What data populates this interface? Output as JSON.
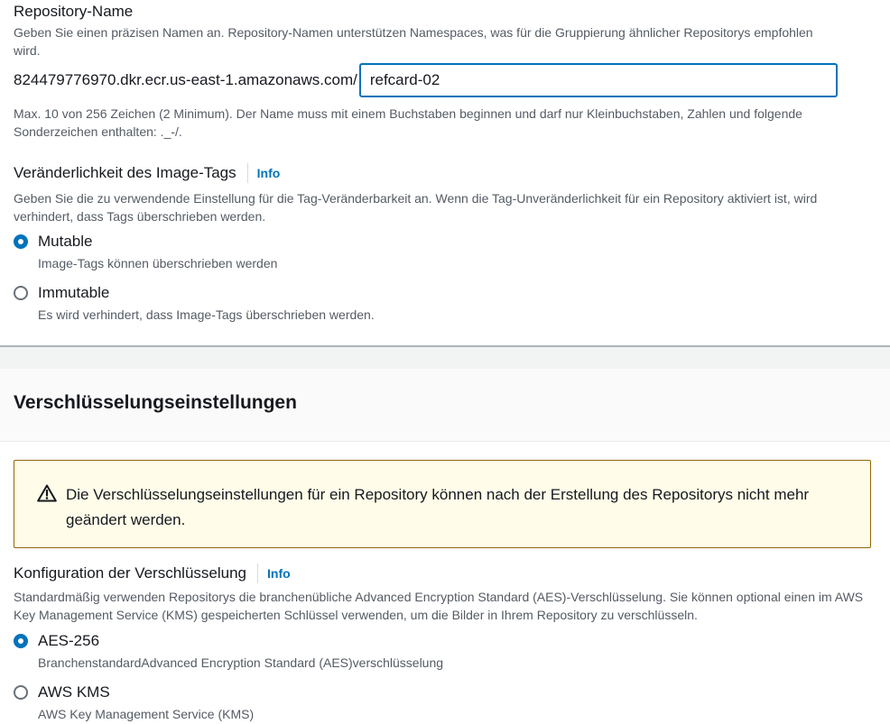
{
  "repo": {
    "name_label": "Repository-Name",
    "name_desc": "Geben Sie einen präzisen Namen an. Repository-Namen unterstützen Namespaces, was für die Gruppierung ähnlicher Repositorys empfohlen wird.",
    "uri_prefix": "824479776970.dkr.ecr.us-east-1.amazonaws.com/",
    "name_value": "refcard-02",
    "constraint": "Max. 10 von 256 Zeichen (2 Minimum). Der Name muss mit einem Buchstaben beginnen und darf nur Kleinbuchstaben, Zahlen und folgende Sonderzeichen enthalten: ._-/."
  },
  "tag_mutability": {
    "heading": "Veränderlichkeit des Image-Tags",
    "info": "Info",
    "desc": "Geben Sie die zu verwendende Einstellung für die Tag-Veränderbarkeit an. Wenn die Tag-Unveränderlichkeit für ein Repository aktiviert ist, wird verhindert, dass Tags überschrieben werden.",
    "options": [
      {
        "label": "Mutable",
        "desc": "Image-Tags können überschrieben werden",
        "checked": true
      },
      {
        "label": "Immutable",
        "desc": "Es wird verhindert, dass Image-Tags überschrieben werden.",
        "checked": false
      }
    ]
  },
  "encryption": {
    "title": "Verschlüsselungseinstellungen",
    "warning": "Die Verschlüsselungseinstellungen für ein Repository können nach der Erstellung des Repositorys nicht mehr geändert werden.",
    "config_heading": "Konfiguration der Verschlüsselung",
    "info": "Info",
    "config_desc": "Standardmäßig verwenden Repositorys die branchenübliche Advanced Encryption Standard (AES)-Verschlüsselung. Sie können optional einen im AWS Key Management Service (KMS) gespeicherten Schlüssel verwenden, um die Bilder in Ihrem Repository zu verschlüsseln.",
    "options": [
      {
        "label": "AES-256",
        "desc": "BranchenstandardAdvanced Encryption Standard (AES)verschlüsselung",
        "checked": true
      },
      {
        "label": "AWS KMS",
        "desc": "AWS Key Management Service (KMS)",
        "checked": false
      }
    ]
  },
  "colors": {
    "accent": "#0073bb",
    "warning_bg": "#fffce9",
    "warning_border": "#906806",
    "warning_icon": "warning-triangle-icon"
  }
}
